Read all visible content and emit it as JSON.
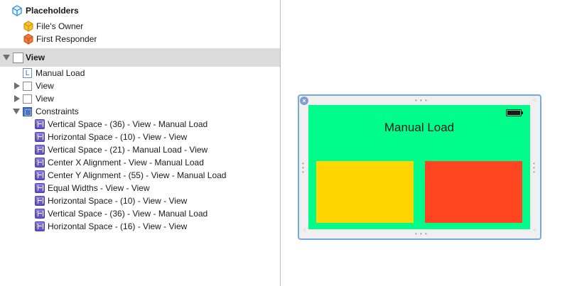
{
  "outline": {
    "placeholders": {
      "title": "Placeholders",
      "files_owner": "File's Owner",
      "first_responder": "First Responder"
    },
    "view": {
      "title": "View",
      "children": [
        {
          "label": "Manual Load",
          "icon": "label-icon"
        },
        {
          "label": "View",
          "icon": "view-icon"
        },
        {
          "label": "View",
          "icon": "view-icon"
        },
        {
          "label": "Constraints",
          "icon": "constraints-icon"
        }
      ],
      "constraints": [
        "Vertical Space - (36) - View - Manual Load",
        "Horizontal Space - (10) - View - View",
        "Vertical Space - (21) - Manual Load - View",
        "Center X Alignment - View - Manual Load",
        "Center Y Alignment - (55) - View - Manual Load",
        "Equal Widths - View - View",
        "Horizontal Space - (10) - View - View",
        "Vertical Space - (36) - View - Manual Load",
        "Horizontal Space - (16) - View - View"
      ]
    }
  },
  "canvas": {
    "label_text": "Manual Load",
    "colors": {
      "root_view": "#00fc8b",
      "yellow_view": "#ffd700",
      "red_view": "#ff4520",
      "selection_row": "#dcdcdc"
    }
  }
}
